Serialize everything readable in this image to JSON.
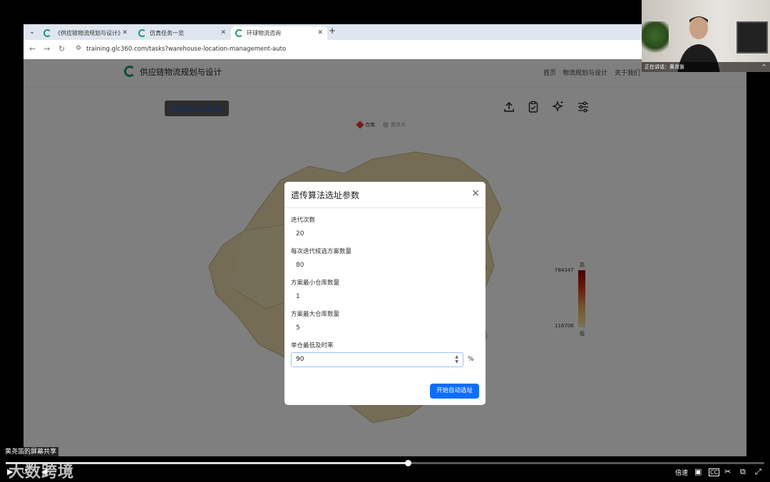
{
  "browser": {
    "tabs": [
      {
        "label": "《供应链物流规划与设计》",
        "active": false
      },
      {
        "label": "仿真任务一览",
        "active": false
      },
      {
        "label": "环球物流咨询",
        "active": true
      }
    ],
    "new_tab": "+",
    "url": "training.glc360.com/tasks?warehouse-location-management-auto"
  },
  "site": {
    "title": "供应链物流规划与设计",
    "nav": [
      "首页",
      "物流规划与设计",
      "关于我们"
    ],
    "view_button": "查看当前仓库布局方案",
    "legend": {
      "warehouse": "仓库",
      "demand": "需求点"
    },
    "scale": {
      "high_label": "高",
      "low_label": "低",
      "max": "784347",
      "min": "116706"
    }
  },
  "modal": {
    "title": "遗传算法选址参数",
    "close": "×",
    "fields": [
      {
        "label": "迭代次数",
        "value": "20"
      },
      {
        "label": "每次迭代候选方案数量",
        "value": "80"
      },
      {
        "label": "方案最小仓库数量",
        "value": "1"
      },
      {
        "label": "方案最大仓库数量",
        "value": "5"
      },
      {
        "label": "单仓最低及时率",
        "value": "90"
      }
    ],
    "unit": "%",
    "submit": "开始自动选址"
  },
  "webcam": {
    "caption": "正在讲话：黄尧笛"
  },
  "video": {
    "share_label": "黄尧笛的屏幕共享",
    "watermark": "大数跨境",
    "speed": "倍速",
    "progress": 0.53
  },
  "colors": {
    "accent": "#0d6efd",
    "brand": "#1a9a78",
    "map_fill": "#e8d9a8"
  }
}
